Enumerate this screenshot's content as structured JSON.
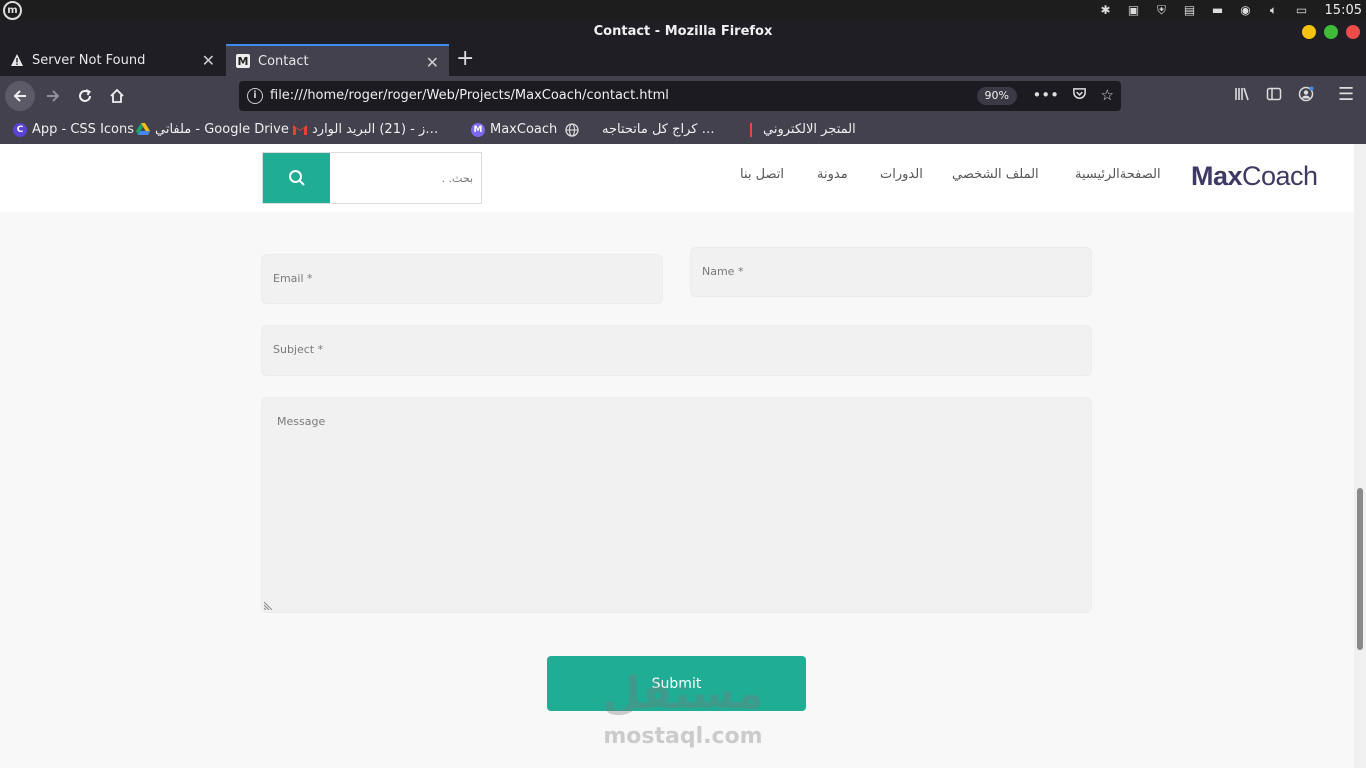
{
  "os": {
    "time": "15:05",
    "colors": {
      "bar": "#1d1d1d"
    }
  },
  "window": {
    "title": "Contact - Mozilla Firefox",
    "controls": {
      "minimize": "#f5c211",
      "maximize": "#3fba3a",
      "close": "#ec4b48"
    }
  },
  "tabs": [
    {
      "label": "Server Not Found",
      "icon": "warning-icon"
    },
    {
      "label": "Contact",
      "icon": "maxcoach-favicon",
      "active": true
    }
  ],
  "toolbar": {
    "url": "file:///home/roger/roger/Web/Projects/MaxCoach/contact.html",
    "zoom": "90%"
  },
  "bookmarks": [
    {
      "label": "App - CSS Icons",
      "icon": "css-icons-favicon"
    },
    {
      "label": "ملفاتي - Google Drive",
      "icon": "google-drive-icon"
    },
    {
      "label": "البريد الوارد ‎(21) - ز…",
      "icon": "gmail-icon"
    },
    {
      "label": "MaxCoach",
      "icon": "maxcoach-favicon"
    },
    {
      "label": "كراج كل ماتحتاجه …",
      "icon": "globe-icon"
    },
    {
      "label": "المتجر الالكتروني",
      "icon": "store-icon"
    }
  ],
  "site": {
    "logo_bold": "Max",
    "logo_rest": "Coach",
    "nav": [
      "الصفحةالرئيسية",
      "الملف الشخصي",
      "الدورات",
      "مدونة",
      "اتصل بنا"
    ],
    "search_placeholder": "بحث. .",
    "accent": "#20ad96"
  },
  "form": {
    "name_placeholder": "Name *",
    "email_placeholder": "Email *",
    "subject_placeholder": "Subject *",
    "message_placeholder": "Message",
    "submit_label": "Submit"
  },
  "watermark": {
    "arabic": "مستقل",
    "latin": "mostaql.com"
  }
}
